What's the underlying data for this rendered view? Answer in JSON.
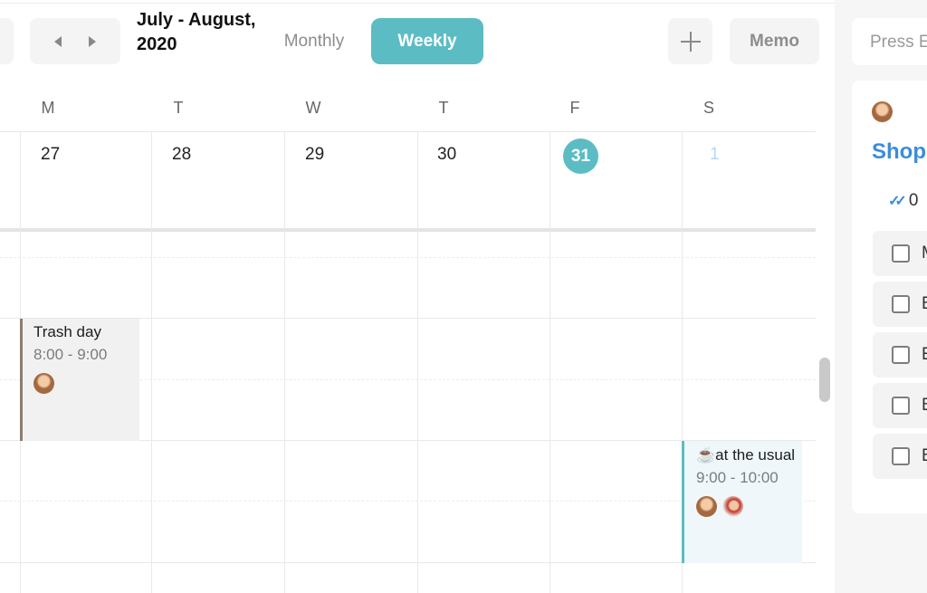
{
  "toolbar": {
    "title": "July - August, 2020",
    "view_monthly": "Monthly",
    "view_weekly": "Weekly",
    "memo_label": "Memo",
    "icons": {
      "prev": "prev-arrow-icon",
      "next": "next-arrow-icon",
      "add": "plus-icon"
    }
  },
  "calendar": {
    "weekdays": [
      "M",
      "T",
      "W",
      "T",
      "F",
      "S"
    ],
    "dates": [
      "27",
      "28",
      "29",
      "30",
      "31",
      "1"
    ],
    "today": "31",
    "accent_color": "#5cbcc3",
    "events": [
      {
        "title": "Trash day",
        "time": "8:00 - 9:00",
        "attendees": 1
      },
      {
        "title": "☕at the usual",
        "time": "9:00 - 10:00",
        "attendees": 2
      }
    ]
  },
  "sidebar": {
    "search_placeholder": "Press E",
    "card": {
      "title": "Shop",
      "progress": "0",
      "items": [
        "M",
        "B",
        "E",
        "B",
        "B"
      ]
    }
  }
}
